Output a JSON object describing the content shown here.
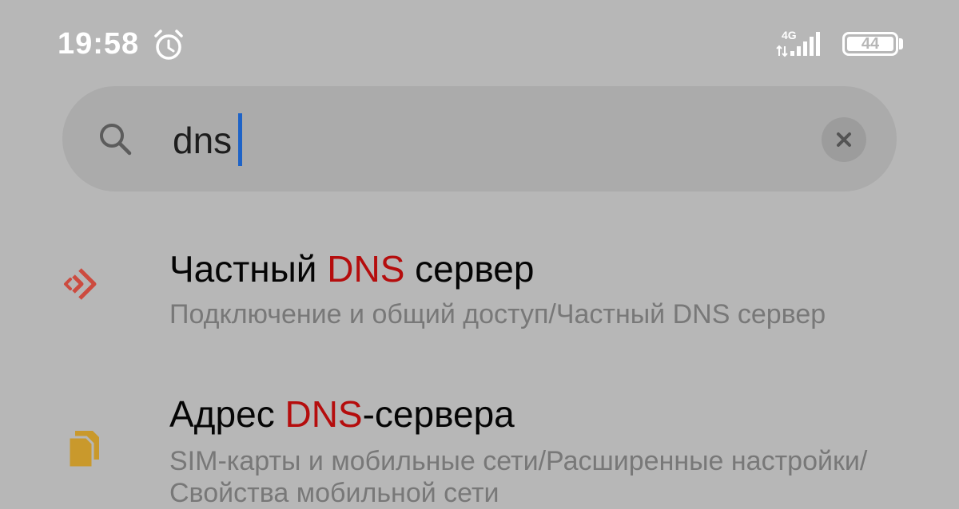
{
  "status_bar": {
    "time": "19:58",
    "network": "4G",
    "battery": "44",
    "icons": [
      "alarm-icon",
      "signal-icon",
      "battery-icon"
    ]
  },
  "search": {
    "query": "dns",
    "icon": "search-icon",
    "clear_icon": "close-icon"
  },
  "results": [
    {
      "icon": "private-dns-icon",
      "icon_color": "#cc4b3f",
      "title_before": "Частный ",
      "title_highlight": "DNS",
      "title_after": " сервер",
      "path": "Подключение и общий доступ/Частный DNS сервер"
    },
    {
      "icon": "sim-cards-icon",
      "icon_color": "#c9992c",
      "title_before": "Адрес ",
      "title_highlight": "DNS",
      "title_after": "-сервера",
      "path": "SIM-карты и мобильные сети/Расширенные настройки/Свойства мобильной сети"
    }
  ],
  "colors": {
    "background": "#b7b7b7",
    "search_bar": "#ababab",
    "highlight": "#b50d0d",
    "caret": "#1e63c7"
  }
}
